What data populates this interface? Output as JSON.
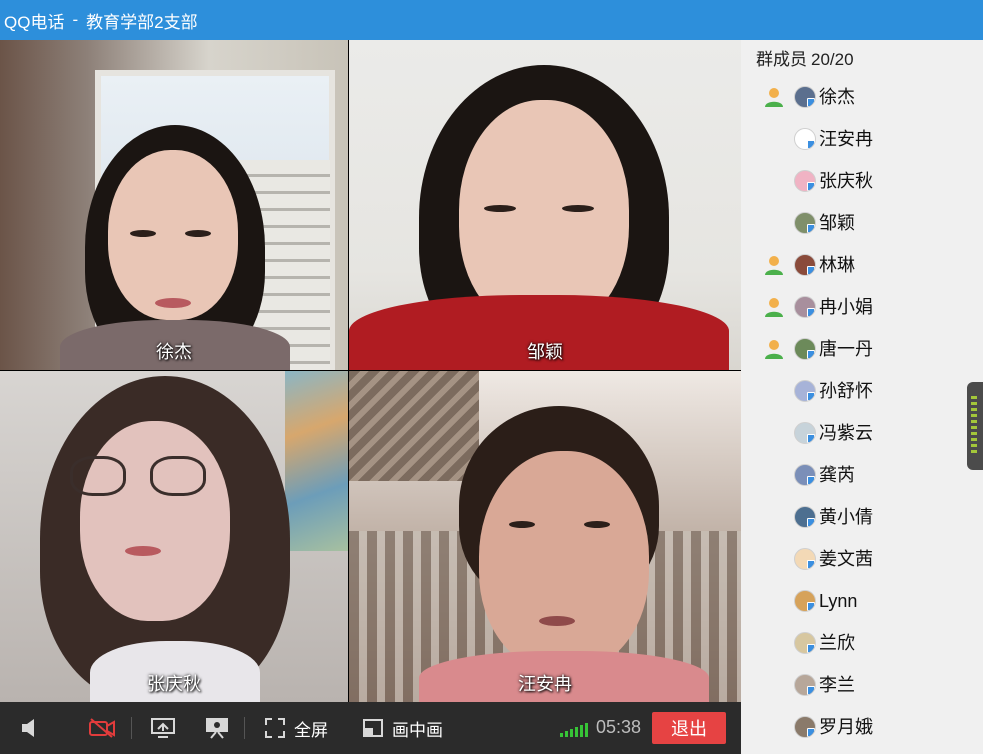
{
  "window": {
    "app_name": "QQ电话",
    "separator": "-",
    "group_name": "教育学部2支部"
  },
  "video_tiles": [
    {
      "name": "徐杰"
    },
    {
      "name": "邹颖"
    },
    {
      "name": "张庆秋"
    },
    {
      "name": "汪安冉"
    }
  ],
  "toolbar": {
    "speaker_icon": "speaker-icon",
    "camera_icon": "camera-off-icon",
    "screen_share_icon": "screen-share-icon",
    "presentation_icon": "presentation-icon",
    "fullscreen_label": "全屏",
    "pip_label": "画中画",
    "timer": "05:38",
    "exit_label": "退出",
    "signal_color": "#37c437",
    "exit_color": "#e64343"
  },
  "members_panel": {
    "title": "群成员",
    "count": "20/20",
    "members": [
      {
        "name": "徐杰",
        "speaking": true
      },
      {
        "name": "汪安冉",
        "speaking": false
      },
      {
        "name": "张庆秋",
        "speaking": false
      },
      {
        "name": "邹颖",
        "speaking": false
      },
      {
        "name": "林琳",
        "speaking": true
      },
      {
        "name": "冉小娟",
        "speaking": true
      },
      {
        "name": "唐一丹",
        "speaking": true
      },
      {
        "name": "孙舒怀",
        "speaking": false
      },
      {
        "name": "冯紫云",
        "speaking": false
      },
      {
        "name": "龚芮",
        "speaking": false
      },
      {
        "name": "黄小倩",
        "speaking": false
      },
      {
        "name": "姜文茜",
        "speaking": false
      },
      {
        "name": "Lynn",
        "speaking": false
      },
      {
        "name": "兰欣",
        "speaking": false
      },
      {
        "name": "李兰",
        "speaking": false
      },
      {
        "name": "罗月娥",
        "speaking": false
      }
    ]
  },
  "colors": {
    "titlebar": "#2d8fdb",
    "toolbar": "#2b2b2b",
    "panel": "#f0f0f0"
  }
}
